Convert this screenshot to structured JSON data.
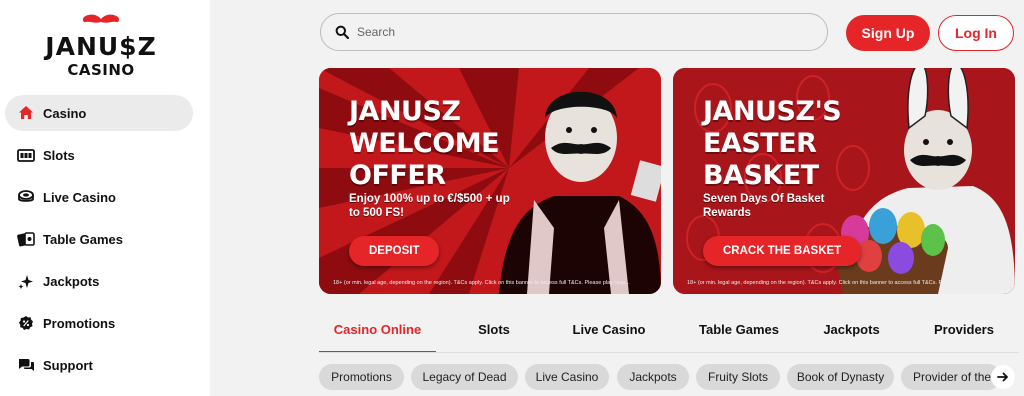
{
  "brand": {
    "logo_line1": "JANU$Z",
    "logo_line2": "CASINO",
    "accent": "#e52528"
  },
  "sidebar": {
    "items": [
      {
        "label": "Casino",
        "icon": "home-icon",
        "active": true
      },
      {
        "label": "Slots",
        "icon": "slot-machine-icon"
      },
      {
        "label": "Live Casino",
        "icon": "live-chip-icon"
      },
      {
        "label": "Table Games",
        "icon": "cards-icon"
      },
      {
        "label": "Jackpots",
        "icon": "sparkle-icon"
      },
      {
        "label": "Promotions",
        "icon": "badge-icon"
      },
      {
        "label": "Support",
        "icon": "chat-icon"
      }
    ]
  },
  "header": {
    "search_placeholder": "Search",
    "signup_label": "Sign Up",
    "login_label": "Log In"
  },
  "banners": [
    {
      "title_lines": [
        "JANUSZ",
        "WELCOME",
        "OFFER"
      ],
      "subtitle": "Enjoy 100% up to €/$500 + up to 500 FS!",
      "cta": "DEPOSIT",
      "fine_print": "18+ (or min. legal age, depending on the region). T&Cs apply. Click on this banner to access full T&Cs. Please play resp..."
    },
    {
      "title_lines": [
        "JANUSZ'S",
        "EASTER",
        "BASKET"
      ],
      "subtitle": "Seven Days Of Basket Rewards",
      "cta": "CRACK THE BASKET",
      "fine_print": "18+ (or min. legal age, depending on the region). T&Cs apply. Click on this banner to access full T&Cs. Please play resp..."
    }
  ],
  "tabs": [
    "Casino Online",
    "Slots",
    "Live Casino",
    "Table Games",
    "Jackpots",
    "Providers"
  ],
  "chips": [
    "Promotions",
    "Legacy of Dead",
    "Live Casino",
    "Jackpots",
    "Fruity Slots",
    "Book of Dynasty",
    "Provider of the"
  ]
}
